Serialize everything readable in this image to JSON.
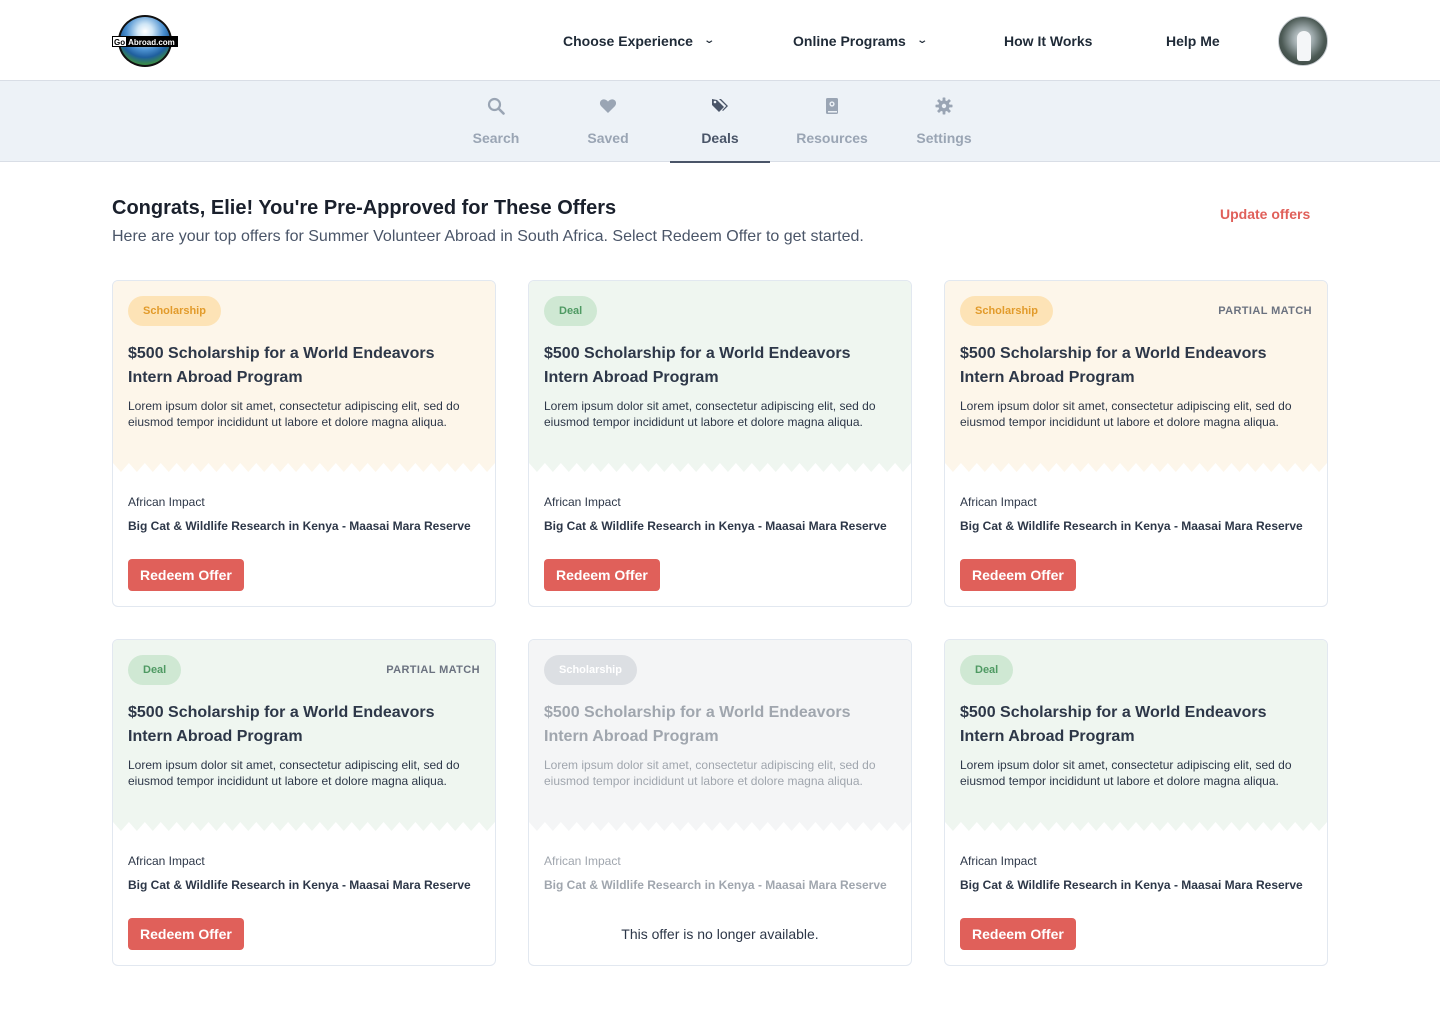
{
  "header": {
    "logo": {
      "go": "Go",
      "abroad": "Abroad.com"
    },
    "nav": [
      {
        "label": "Choose Experience",
        "has_dropdown": true
      },
      {
        "label": "Online Programs",
        "has_dropdown": true
      },
      {
        "label": "How It Works",
        "has_dropdown": false
      },
      {
        "label": "Help Me",
        "has_dropdown": false
      }
    ]
  },
  "subnav": {
    "tabs": [
      {
        "label": "Search",
        "icon": "search-icon"
      },
      {
        "label": "Saved",
        "icon": "heart-icon"
      },
      {
        "label": "Deals",
        "icon": "tags-icon",
        "active": true
      },
      {
        "label": "Resources",
        "icon": "book-icon"
      },
      {
        "label": "Settings",
        "icon": "gear-icon"
      }
    ]
  },
  "main": {
    "title": "Congrats, Elie! You're Pre-Approved for These Offers",
    "subtitle": "Here are your top offers for Summer Volunteer Abroad in South Africa. Select Redeem Offer to get started.",
    "update_link": "Update offers",
    "redeem_label": "Redeem Offer",
    "unavailable_text": "This offer is no longer available.",
    "offers": [
      {
        "type": "Scholarship",
        "partial": "",
        "title": "$500 Scholarship for a World Endeavors Intern Abroad Program",
        "description": "Lorem ipsum dolor sit amet, consectetur adipiscing elit, sed do eiusmod tempor incididunt ut labore et dolore magna aliqua.",
        "provider": "African Impact",
        "program": "Big Cat & Wildlife Research in Kenya - Maasai Mara Reserve",
        "available": true
      },
      {
        "type": "Deal",
        "partial": "",
        "title": "$500 Scholarship for a World Endeavors Intern Abroad Program",
        "description": "Lorem ipsum dolor sit amet, consectetur adipiscing elit, sed do eiusmod tempor incididunt ut labore et dolore magna aliqua.",
        "provider": "African Impact",
        "program": "Big Cat & Wildlife Research in Kenya - Maasai Mara Reserve",
        "available": true
      },
      {
        "type": "Scholarship",
        "partial": "PARTIAL MATCH",
        "title": "$500 Scholarship for a World Endeavors Intern Abroad Program",
        "description": "Lorem ipsum dolor sit amet, consectetur adipiscing elit, sed do eiusmod tempor incididunt ut labore et dolore magna aliqua.",
        "provider": "African Impact",
        "program": "Big Cat & Wildlife Research in Kenya - Maasai Mara Reserve",
        "available": true
      },
      {
        "type": "Deal",
        "partial": "PARTIAL MATCH",
        "title": "$500 Scholarship for a World Endeavors Intern Abroad Program",
        "description": "Lorem ipsum dolor sit amet, consectetur adipiscing elit, sed do eiusmod tempor incididunt ut labore et dolore magna aliqua.",
        "provider": "African Impact",
        "program": "Big Cat & Wildlife Research in Kenya - Maasai Mara Reserve",
        "available": true
      },
      {
        "type": "Scholarship",
        "partial": "",
        "title": "$500 Scholarship for a World Endeavors Intern Abroad Program",
        "description": "Lorem ipsum dolor sit amet, consectetur adipiscing elit, sed do eiusmod tempor incididunt ut labore et dolore magna aliqua.",
        "provider": "African Impact",
        "program": "Big Cat & Wildlife Research in Kenya - Maasai Mara Reserve",
        "available": false
      },
      {
        "type": "Deal",
        "partial": "",
        "title": "$500 Scholarship for a World Endeavors Intern Abroad Program",
        "description": "Lorem ipsum dolor sit amet, consectetur adipiscing elit, sed do eiusmod tempor incididunt ut labore et dolore magna aliqua.",
        "provider": "African Impact",
        "program": "Big Cat & Wildlife Research in Kenya - Maasai Mara Reserve",
        "available": true
      }
    ]
  },
  "colors": {
    "accent_red": "#e0605a",
    "scholarship_bg": "#fdf6ea",
    "scholarship_badge": "#fde3b6",
    "deal_bg": "#eff6f0",
    "deal_badge": "#cfe8d3",
    "subnav_bg": "#edf2f7"
  }
}
